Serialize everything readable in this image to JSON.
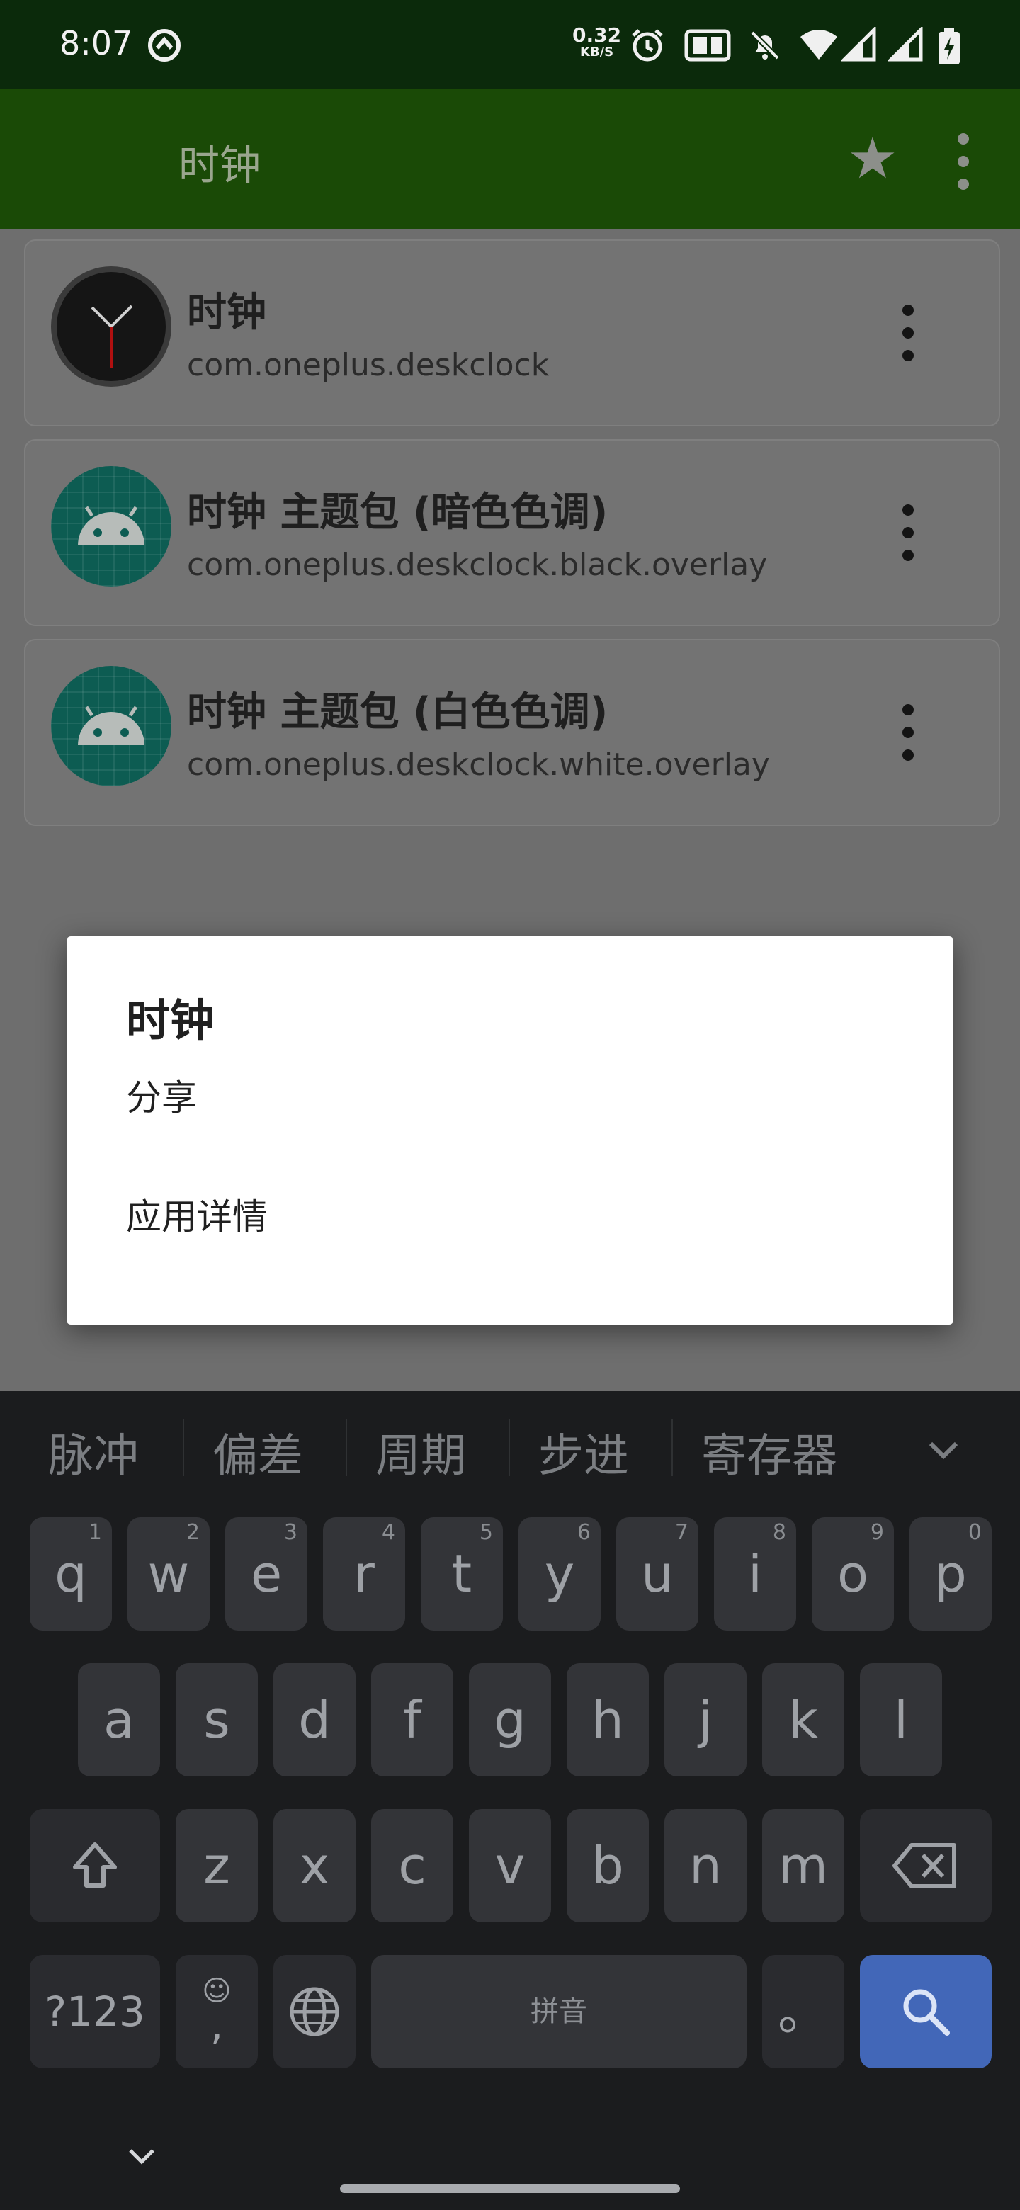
{
  "status_bar": {
    "time": "8:07",
    "net_speed_value": "0.32",
    "net_speed_unit": "KB/S",
    "icons": [
      "vpn-icon",
      "alarm-icon",
      "volte-icon",
      "mute-icon",
      "wifi-icon",
      "signal-icon",
      "signal-icon",
      "battery-charging-icon"
    ]
  },
  "app_bar": {
    "title": "时钟",
    "icons": [
      "star-icon",
      "more-vert-icon"
    ]
  },
  "list": {
    "items": [
      {
        "name": "时钟",
        "package": "com.oneplus.deskclock",
        "icon": "clock-app-icon"
      },
      {
        "name": "时钟 主题包 (暗色色调)",
        "package": "com.oneplus.deskclock.black.overlay",
        "icon": "android-app-icon"
      },
      {
        "name": "时钟 主题包 (白色色调)",
        "package": "com.oneplus.deskclock.white.overlay",
        "icon": "android-app-icon"
      }
    ]
  },
  "dialog": {
    "title": "时钟",
    "items": [
      "分享",
      "应用详情"
    ]
  },
  "keyboard": {
    "candidates": [
      "脉冲",
      "偏差",
      "周期",
      "步进",
      "寄存器"
    ],
    "row1": [
      {
        "key": "q",
        "hint": "1"
      },
      {
        "key": "w",
        "hint": "2"
      },
      {
        "key": "e",
        "hint": "3"
      },
      {
        "key": "r",
        "hint": "4"
      },
      {
        "key": "t",
        "hint": "5"
      },
      {
        "key": "y",
        "hint": "6"
      },
      {
        "key": "u",
        "hint": "7"
      },
      {
        "key": "i",
        "hint": "8"
      },
      {
        "key": "o",
        "hint": "9"
      },
      {
        "key": "p",
        "hint": "0"
      }
    ],
    "row2": [
      "a",
      "s",
      "d",
      "f",
      "g",
      "h",
      "j",
      "k",
      "l"
    ],
    "row3": [
      "z",
      "x",
      "c",
      "v",
      "b",
      "n",
      "m"
    ],
    "symbols_key": "?123",
    "emoji_hint": "☺",
    "comma": ",",
    "space_label": "拼音",
    "period": "。"
  },
  "colors": {
    "status_bar": "#0b2a0b",
    "app_bar": "#1a4a06",
    "keyboard_bg": "#1b1c1e",
    "key_bg": "#333438",
    "search_key": "#4267b8",
    "dialog_bg": "#ffffff"
  }
}
